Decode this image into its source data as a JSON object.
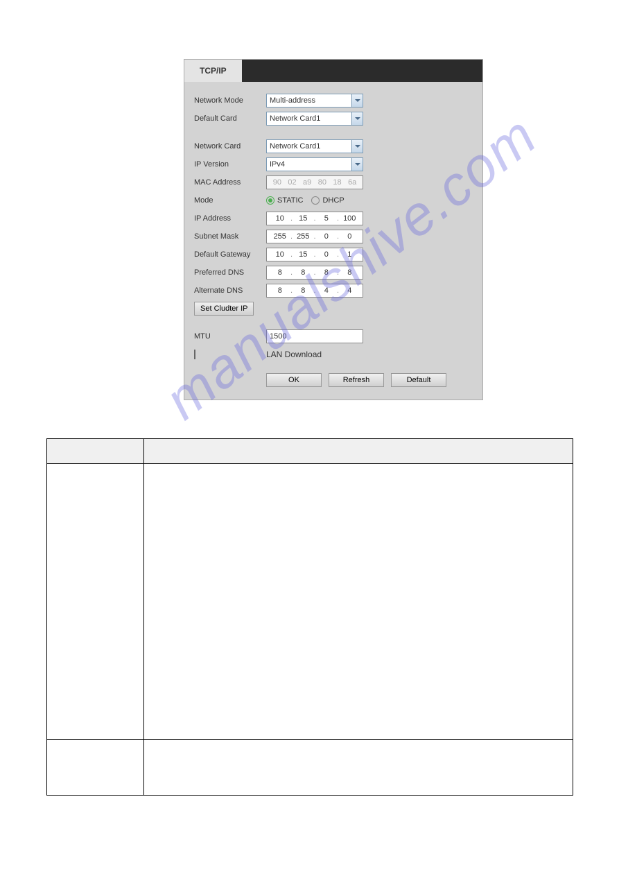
{
  "tab": {
    "label": "TCP/IP"
  },
  "form": {
    "network_mode": {
      "label": "Network Mode",
      "value": "Multi-address"
    },
    "default_card": {
      "label": "Default Card",
      "value": "Network Card1"
    },
    "network_card": {
      "label": "Network Card",
      "value": "Network Card1"
    },
    "ip_version": {
      "label": "IP Version",
      "value": "IPv4"
    },
    "mac_address": {
      "label": "MAC Address",
      "o1": "90",
      "o2": "02",
      "o3": "a9",
      "o4": "80",
      "o5": "18",
      "o6": "6a"
    },
    "mode": {
      "label": "Mode",
      "static": "STATIC",
      "dhcp": "DHCP",
      "selected": "static"
    },
    "ip_address": {
      "label": "IP Address",
      "o1": "10",
      "o2": "15",
      "o3": "5",
      "o4": "100"
    },
    "subnet_mask": {
      "label": "Subnet Mask",
      "o1": "255",
      "o2": "255",
      "o3": "0",
      "o4": "0"
    },
    "default_gateway": {
      "label": "Default Gateway",
      "o1": "10",
      "o2": "15",
      "o3": "0",
      "o4": "1"
    },
    "preferred_dns": {
      "label": "Preferred DNS",
      "o1": "8",
      "o2": "8",
      "o3": "8",
      "o4": "8"
    },
    "alternate_dns": {
      "label": "Alternate DNS",
      "o1": "8",
      "o2": "8",
      "o3": "4",
      "o4": "4"
    },
    "set_cluster": {
      "label": "Set Cludter IP"
    },
    "mtu": {
      "label": "MTU",
      "value": "1500"
    },
    "lan_download": {
      "label": "LAN Download"
    },
    "buttons": {
      "ok": "OK",
      "refresh": "Refresh",
      "default": "Default"
    }
  },
  "watermark": "manualshive.com"
}
